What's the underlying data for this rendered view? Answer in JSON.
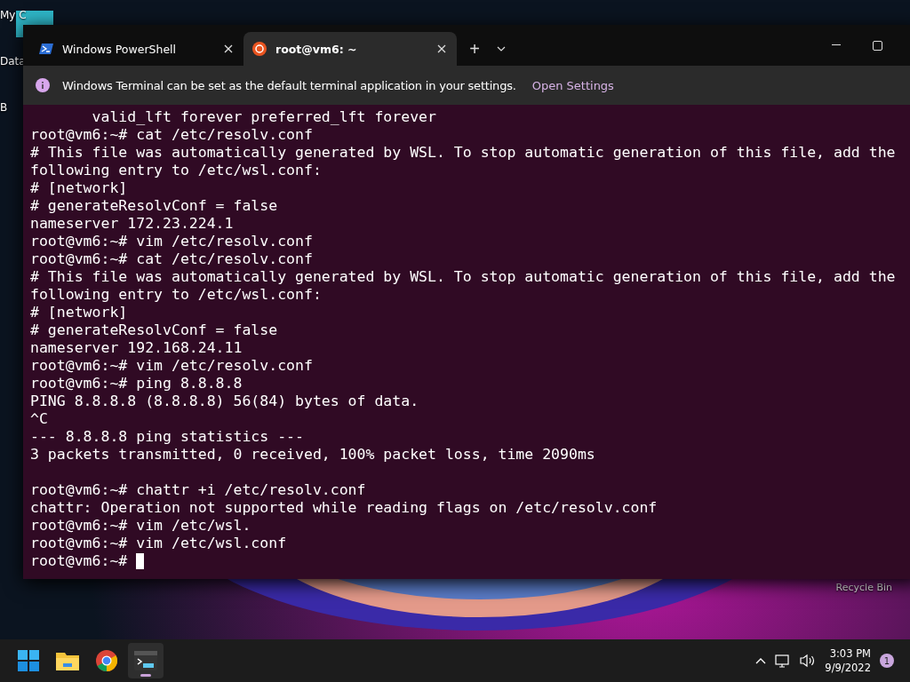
{
  "desktop": {
    "icons": [
      {
        "label": "My C"
      },
      {
        "label": "Data"
      },
      {
        "label": "B"
      }
    ],
    "recycle_bin": {
      "label": "Recycle Bin"
    }
  },
  "window": {
    "tabs": [
      {
        "label": "Windows PowerShell",
        "kind": "powershell",
        "selected": false
      },
      {
        "label": "root@vm6: ~",
        "kind": "ubuntu",
        "selected": true
      }
    ],
    "new_tab": "+",
    "banner": {
      "message": "Windows Terminal can be set as the default terminal application in your settings.",
      "link": "Open Settings"
    },
    "terminal": {
      "lines": [
        {
          "text": "       valid_lft forever preferred_lft forever"
        },
        {
          "text": "root@vm6:~# cat /etc/resolv.conf"
        },
        {
          "text": "# This file was automatically generated by WSL. To stop automatic generation of this file, add the"
        },
        {
          "text": "following entry to /etc/wsl.conf:"
        },
        {
          "text": "# [network]"
        },
        {
          "text": "# generateResolvConf = false"
        },
        {
          "text": "nameserver 172.23.224.1"
        },
        {
          "text": "root@vm6:~# vim /etc/resolv.conf"
        },
        {
          "text": "root@vm6:~# cat /etc/resolv.conf"
        },
        {
          "text": "# This file was automatically generated by WSL. To stop automatic generation of this file, add the"
        },
        {
          "text": "following entry to /etc/wsl.conf:"
        },
        {
          "text": "# [network]"
        },
        {
          "text": "# generateResolvConf = false"
        },
        {
          "text": "nameserver 192.168.24.11"
        },
        {
          "text": "root@vm6:~# vim /etc/resolv.conf"
        },
        {
          "text": "root@vm6:~# ping 8.8.8.8"
        },
        {
          "text": "PING 8.8.8.8 (8.8.8.8) 56(84) bytes of data."
        },
        {
          "text": "^C"
        },
        {
          "text": "--- 8.8.8.8 ping statistics ---"
        },
        {
          "text": "3 packets transmitted, 0 received, 100% packet loss, time 2090ms"
        },
        {
          "text": "root@vm6:~# chattr +i /etc/resolv.conf",
          "space_before": true
        },
        {
          "text": "chattr: Operation not supported while reading flags on /etc/resolv.conf"
        },
        {
          "text": "root@vm6:~# vim /etc/wsl."
        },
        {
          "text": "root@vm6:~# vim /etc/wsl.conf"
        },
        {
          "text": "root@vm6:~# ",
          "cursor": true
        }
      ]
    }
  },
  "taskbar": {
    "apps": [
      {
        "kind": "start",
        "selected": false
      },
      {
        "kind": "explorer",
        "selected": false
      },
      {
        "kind": "chrome",
        "selected": false
      },
      {
        "kind": "terminal",
        "selected": true
      }
    ],
    "time": "3:03 PM",
    "date": "9/9/2022",
    "notifications": "1"
  }
}
